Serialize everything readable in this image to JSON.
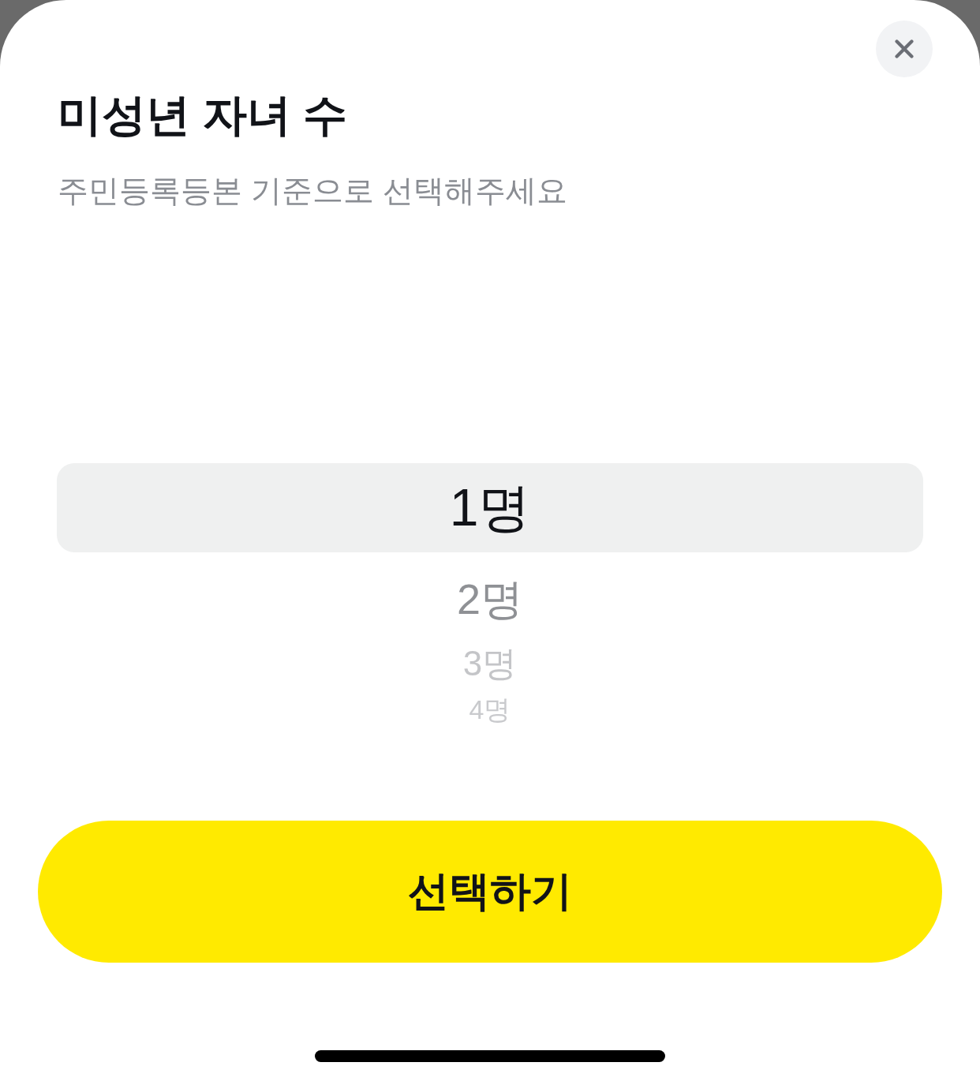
{
  "sheet": {
    "title": "미성년 자녀 수",
    "subtitle": "주민등록등본 기준으로 선택해주세요"
  },
  "picker": {
    "options": [
      {
        "label": "1명",
        "selected": true
      },
      {
        "label": "2명",
        "selected": false
      },
      {
        "label": "3명",
        "selected": false
      },
      {
        "label": "4명",
        "selected": false
      }
    ]
  },
  "confirm_button": {
    "label": "선택하기"
  }
}
